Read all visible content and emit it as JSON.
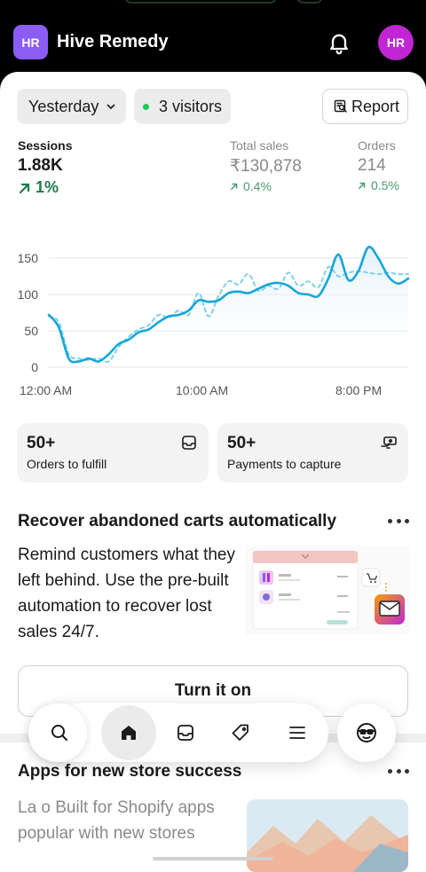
{
  "header": {
    "store_initials": "HR",
    "store_name": "Hive Remedy",
    "user_initials": "HR"
  },
  "filters": {
    "date_range": "Yesterday",
    "visitors": "3 visitors",
    "report_label": "Report"
  },
  "metrics": [
    {
      "label": "Sessions",
      "value": "1.88K",
      "delta": "1%"
    },
    {
      "label": "Total sales",
      "value": "₹130,878",
      "delta": "0.4%"
    },
    {
      "label": "Orders",
      "value": "214",
      "delta": "0.5%"
    }
  ],
  "chart_data": {
    "type": "line",
    "y_ticks": [
      "150",
      "100",
      "50",
      "0"
    ],
    "x_ticks": [
      "12:00 AM",
      "10:00 AM",
      "8:00 PM"
    ],
    "ylim": [
      0,
      175
    ],
    "grid": true,
    "series": [
      {
        "line_style": "solid",
        "color": "#16a6d9",
        "x": [
          0,
          1,
          2,
          3,
          4,
          5,
          6,
          7,
          8,
          9,
          10,
          11,
          12,
          13,
          14,
          15,
          16,
          17,
          18,
          19,
          20,
          21,
          22,
          23,
          24,
          25,
          26,
          27,
          28,
          29,
          30,
          31,
          32,
          33,
          34,
          35,
          36
        ],
        "y": [
          72,
          55,
          12,
          8,
          12,
          8,
          18,
          32,
          38,
          48,
          52,
          62,
          70,
          72,
          78,
          92,
          90,
          92,
          102,
          104,
          102,
          108,
          114,
          116,
          112,
          102,
          100,
          98,
          122,
          155,
          120,
          132,
          165,
          150,
          125,
          115,
          122
        ]
      },
      {
        "line_style": "dashed",
        "color": "#7fd0e8",
        "x": [
          0,
          1,
          2,
          3,
          4,
          5,
          6,
          7,
          8,
          9,
          10,
          11,
          12,
          13,
          14,
          15,
          16,
          17,
          18,
          19,
          20,
          21,
          22,
          23,
          24,
          25,
          26,
          27,
          28,
          29,
          30,
          31,
          32,
          33,
          34,
          35,
          36
        ],
        "y": [
          70,
          62,
          18,
          12,
          10,
          12,
          8,
          28,
          42,
          52,
          58,
          72,
          68,
          78,
          72,
          102,
          70,
          98,
          118,
          114,
          128,
          105,
          112,
          108,
          130,
          112,
          118,
          110,
          138,
          125,
          130,
          132,
          130,
          128,
          130,
          128,
          128
        ]
      }
    ]
  },
  "cards": [
    {
      "count": "50+",
      "label": "Orders to fulfill",
      "icon": "inbox-icon"
    },
    {
      "count": "50+",
      "label": "Payments to capture",
      "icon": "cash-icon"
    }
  ],
  "promo": {
    "title": "Recover abandoned carts automatically",
    "body": "Remind customers what they left behind. Use the pre-built automation to recover lost sales 24/7.",
    "button": "Turn it on"
  },
  "apps": {
    "title": "Apps for new store success",
    "body": "La    o   Built for Shopify apps popular with new stores"
  },
  "colors": {
    "accent_line": "#16a6d9",
    "positive": "#1f7a4a",
    "store_avatar": "#8b5cf6",
    "user_avatar": "#c026d3"
  },
  "tabs": [
    "search-icon",
    "home-icon",
    "inbox-icon",
    "tag-icon",
    "menu-icon",
    "sidekick-icon"
  ]
}
